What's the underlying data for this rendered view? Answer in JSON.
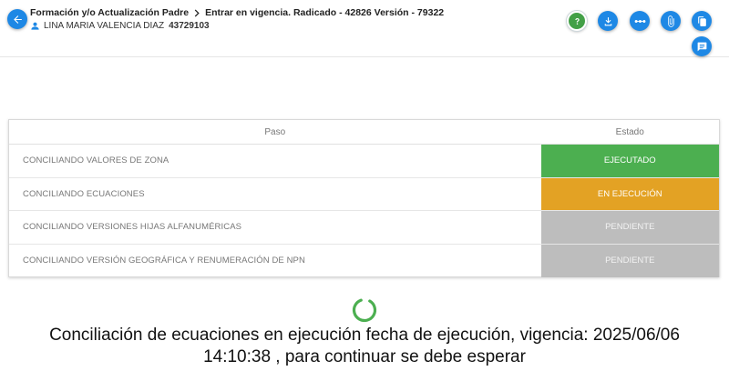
{
  "header": {
    "breadcrumb": [
      "Formación y/o Actualización Padre",
      "Entrar en vigencia. Radicado - 42826 Versión - 79322"
    ],
    "user_name": "LINA MARIA VALENCIA DIAZ",
    "user_id": "43729103"
  },
  "colors": {
    "primary": "#1e88e5",
    "executed": "#4caf50",
    "running": "#e3a224",
    "pending": "#bdbdbd"
  },
  "table": {
    "headers": [
      "Paso",
      "Estado"
    ],
    "rows": [
      {
        "step": "CONCILIANDO VALORES DE ZONA",
        "status": "EJECUTADO",
        "state": "executed"
      },
      {
        "step": "CONCILIANDO ECUACIONES",
        "status": "EN EJECUCIÓN",
        "state": "running"
      },
      {
        "step": "CONCILIANDO VERSIONES HIJAS ALFANUMÉRICAS",
        "status": "PENDIENTE",
        "state": "pending"
      },
      {
        "step": "CONCILIANDO VERSIÓN GEOGRÁFICA Y RENUMERACIÓN DE NPN",
        "status": "PENDIENTE",
        "state": "pending"
      }
    ]
  },
  "message": {
    "line1": "Conciliación de ecuaciones en ejecución fecha de ejecución, vigencia: 2025/06/06",
    "line2": "14:10:38 , para continuar se debe esperar"
  },
  "icons": [
    "arrow-left-icon",
    "chevron-right-icon",
    "person-icon",
    "help-icon",
    "download-icon",
    "dots-icon",
    "paperclip-icon",
    "copy-icon",
    "comment-icon",
    "spinner-icon"
  ]
}
